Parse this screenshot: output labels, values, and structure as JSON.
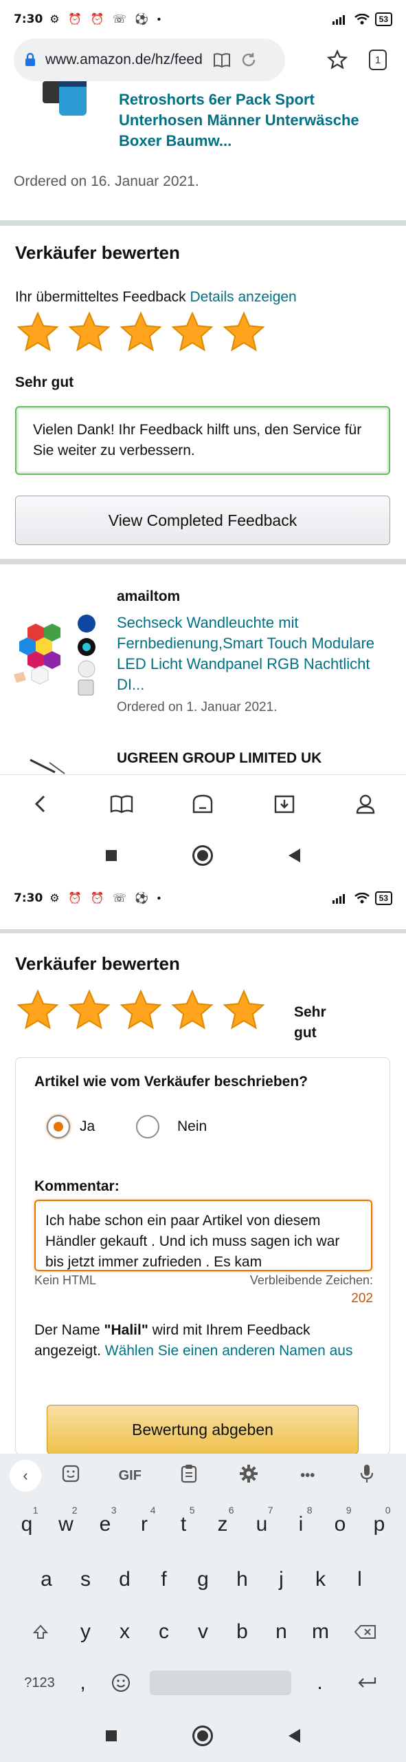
{
  "status_top": {
    "time": "7:30",
    "icons": "⚙ ⏰ ⏰ ☏ ⚽ •",
    "signal": "ıll",
    "wifi": "wifi",
    "battery": "53"
  },
  "browser": {
    "url": "www.amazon.de/hz/feedb",
    "tab_count": "1"
  },
  "top_product": {
    "title": "Retroshorts 6er Pack Sport Unterhosen Männer Unterwäsche Boxer Baumw...",
    "ordered": "Ordered on 16. Januar 2021."
  },
  "seller_rating_1": {
    "heading": "Verkäufer bewerten",
    "feedback_prefix": "Ihr übermitteltes Feedback",
    "details_link": "Details anzeigen",
    "stars": 5,
    "rating_word": "Sehr gut",
    "thanks_text": "Vielen Dank! Ihr Feedback hilft uns, den Service für Sie weiter zu verbessern.",
    "completed_button": "View Completed Feedback"
  },
  "order2": {
    "seller": "amailtom",
    "title": "Sechseck Wandleuchte mit Fernbedienung,Smart Touch Modulare LED Licht Wandpanel RGB Nachtlicht DI...",
    "ordered": "Ordered on 1. Januar 2021.",
    "next_seller": "UGREEN GROUP LIMITED UK"
  },
  "status_bottom": {
    "time": "7:30",
    "icons": "⚙ ⏰ ⏰ ☏ ⚽ •",
    "battery": "53"
  },
  "seller_rating_2": {
    "heading": "Verkäufer bewerten",
    "stars": 5,
    "rating_word": "Sehr gut",
    "question": "Artikel wie vom Verkäufer beschrieben?",
    "yes": "Ja",
    "no": "Nein",
    "comment_label": "Kommentar:",
    "comment_value": "Ich habe schon ein paar Artikel von diesem Händler gekauft . Und ich muss sagen ich war bis jetzt immer zufrieden . Es kam",
    "no_html": "Kein HTML",
    "remaining_label": "Verbleibende Zeichen:",
    "remaining_count": "202",
    "name_prefix": "Der Name ",
    "name": "\"Halil\"",
    "name_suffix": " wird mit Ihrem Feedback angezeigt. ",
    "choose_name_link": "Wählen Sie einen anderen Namen aus",
    "submit": "Bewertung abgeben"
  },
  "keyboard": {
    "toolbar_gif": "GIF",
    "row1": [
      {
        "k": "q",
        "n": "1"
      },
      {
        "k": "w",
        "n": "2"
      },
      {
        "k": "e",
        "n": "3"
      },
      {
        "k": "r",
        "n": "4"
      },
      {
        "k": "t",
        "n": "5"
      },
      {
        "k": "z",
        "n": "6"
      },
      {
        "k": "u",
        "n": "7"
      },
      {
        "k": "i",
        "n": "8"
      },
      {
        "k": "o",
        "n": "9"
      },
      {
        "k": "p",
        "n": "0"
      }
    ],
    "row2": [
      "a",
      "s",
      "d",
      "f",
      "g",
      "h",
      "j",
      "k",
      "l"
    ],
    "row3": [
      "y",
      "x",
      "c",
      "v",
      "b",
      "n",
      "m"
    ],
    "sym": "?123",
    "comma": ",",
    "period": "."
  },
  "colors": {
    "link": "#007185",
    "star": "#ffa41c",
    "divider": "#d5dbdb",
    "button_yellow": "#f0c14b",
    "accent": "#e77600"
  }
}
